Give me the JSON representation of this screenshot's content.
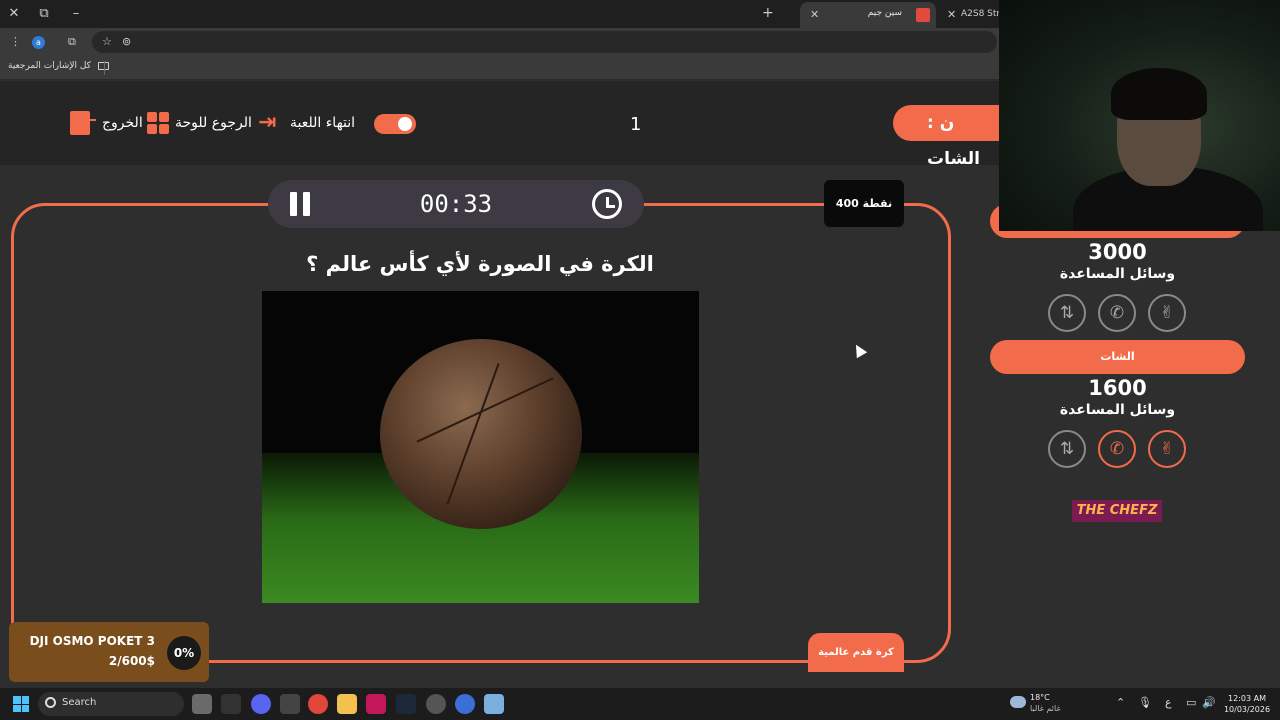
{
  "browser": {
    "window_controls": [
      "✕",
      "⧉",
      "–"
    ],
    "tabs": [
      {
        "title": "سين جيم",
        "active": true
      },
      {
        "title": "A2S8 Strea",
        "active": false
      }
    ],
    "new_tab_label": "+",
    "close_label": "✕",
    "bookmarks_label": "كل الإشارات المرجعية",
    "profile_initial": "a"
  },
  "game": {
    "exit_label": "الخروج",
    "back_label": "الرجوع للوحة",
    "end_label": "انتهاء اللعبة",
    "round_number": "1",
    "team_pill": "ن : الشات",
    "timer": "00:33",
    "points_badge": "400 نقطة",
    "question": "الكرة في الصورة لأي كأس عالم ؟",
    "answer_label": "كرة قدم عالمية"
  },
  "teams": [
    {
      "name": "",
      "score": "3000",
      "aids_title": "وسائل المساعدة",
      "aids": [
        {
          "icon": "swap-icon",
          "glyph": "⇅",
          "active": false
        },
        {
          "icon": "phone-icon",
          "glyph": "✆",
          "active": false
        },
        {
          "icon": "peace-hand-icon",
          "glyph": "✌",
          "active": false
        }
      ]
    },
    {
      "name": "الشات",
      "score": "1600",
      "aids_title": "وسائل المساعدة",
      "aids": [
        {
          "icon": "swap-icon",
          "glyph": "⇅",
          "active": false
        },
        {
          "icon": "phone-icon",
          "glyph": "✆",
          "active": true
        },
        {
          "icon": "peace-hand-icon",
          "glyph": "✌",
          "active": true
        }
      ]
    }
  ],
  "brand": {
    "the": "THE ",
    "chefz": "CHEFZ"
  },
  "donation": {
    "title": "DJI OSMO POKET 3",
    "amount": "2/600$",
    "percent": "0%"
  },
  "taskbar": {
    "search_placeholder": "Search",
    "weather_temp": "18°C",
    "weather_desc": "غائم غالبا",
    "time": "12:03 AM",
    "date": "10/03/2026",
    "lang": "ع"
  },
  "colors": {
    "accent": "#f26b4a",
    "background": "#2e2e2e"
  }
}
